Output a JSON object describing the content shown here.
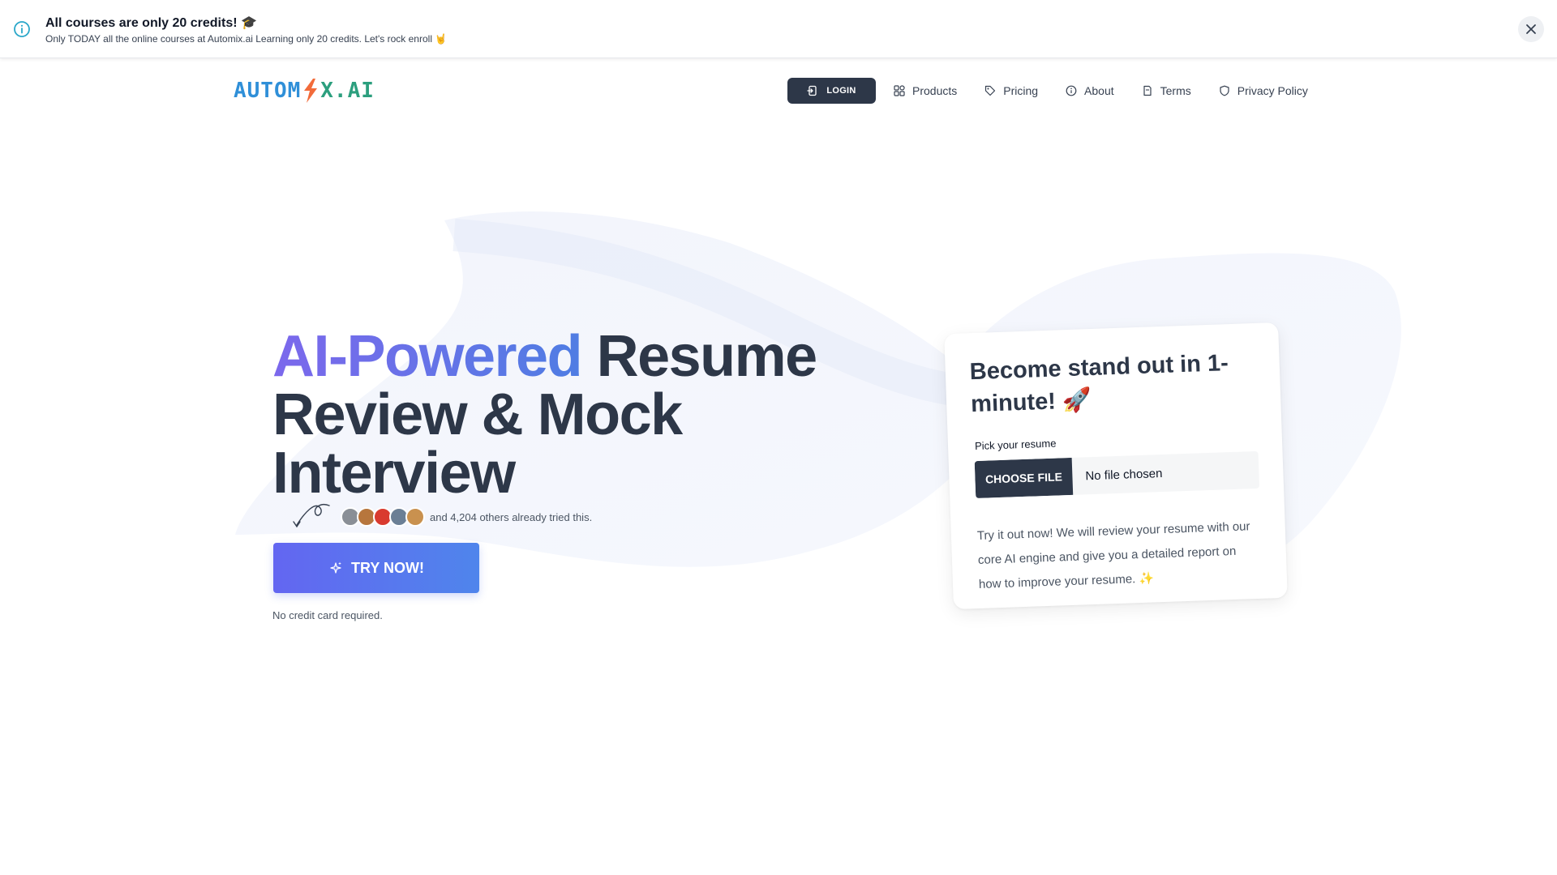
{
  "banner": {
    "title": "All courses are only 20 credits! 🎓",
    "text": "Only TODAY all the online courses at Automix.ai Learning only 20 credits. Let's rock enroll 🤘"
  },
  "logo": {
    "part1": "AUTOM",
    "part2": "X.AI",
    "colors": {
      "blue": "#2f8fd8",
      "green": "#2c9f7e",
      "bolt": "#f26b3a"
    }
  },
  "nav": {
    "login": "LOGIN",
    "items": [
      {
        "label": "Products",
        "icon": "grid-icon"
      },
      {
        "label": "Pricing",
        "icon": "tag-icon"
      },
      {
        "label": "About",
        "icon": "info-icon"
      },
      {
        "label": "Terms",
        "icon": "document-icon"
      },
      {
        "label": "Privacy Policy",
        "icon": "shield-icon"
      }
    ]
  },
  "hero": {
    "title_highlight": "AI-Powered",
    "title_rest_1": " Resume",
    "title_rest_2": "Review & Mock Interview",
    "social_text": "and 4,204 others already tried this.",
    "avatar_colors": [
      "#8a8f96",
      "#b7763d",
      "#d93a2f",
      "#6b7f95",
      "#c9914f"
    ],
    "cta": "TRY NOW!",
    "note": "No credit card required."
  },
  "card": {
    "title": "Become stand out in 1-minute! 🚀",
    "label": "Pick your resume",
    "choose_file": "CHOOSE FILE",
    "no_file": "No file chosen",
    "description": "Try it out now! We will review your resume with our core AI engine and give you a detailed report on how to improve your resume. ✨"
  },
  "colors": {
    "primary_dark": "#2d3748",
    "gradient_start": "#6366f1",
    "gradient_end": "#4f85ec",
    "info_icon": "#2aa7c9"
  }
}
